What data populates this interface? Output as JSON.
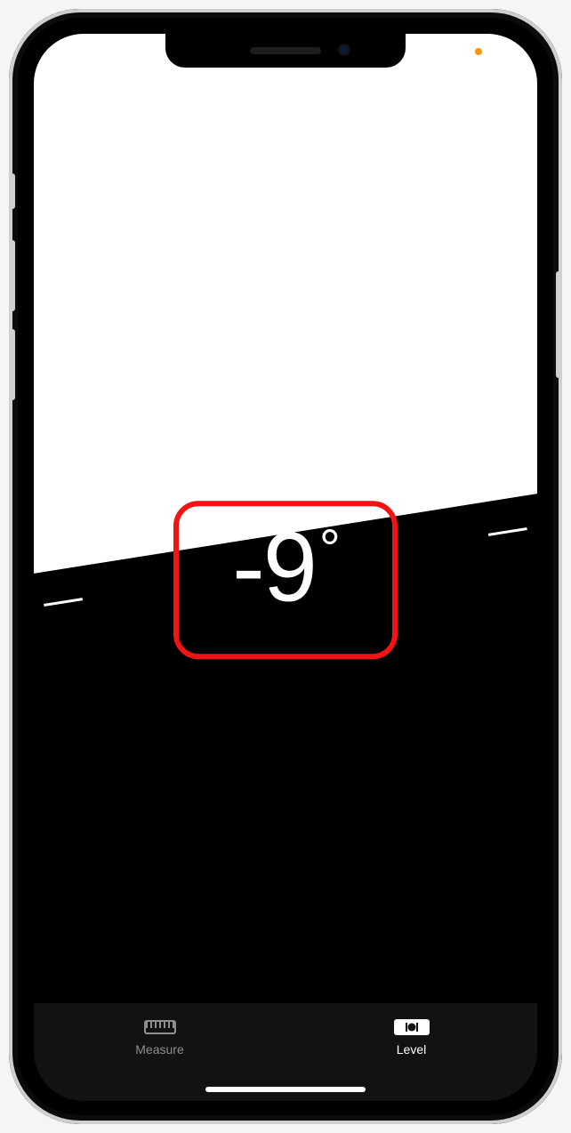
{
  "status_bar": {
    "mic_indicator_color": "#ff9500"
  },
  "level": {
    "angle_value": "-9",
    "angle_unit": "°",
    "tilt_deg": -9,
    "sky_color": "#ffffff",
    "ground_color": "#000000",
    "text_color": "#ffffff"
  },
  "annotation": {
    "color": "#f01414"
  },
  "tabbar": {
    "items": [
      {
        "id": "measure",
        "label": "Measure",
        "icon": "ruler-icon",
        "active": false
      },
      {
        "id": "level",
        "label": "Level",
        "icon": "level-icon",
        "active": true
      }
    ]
  }
}
